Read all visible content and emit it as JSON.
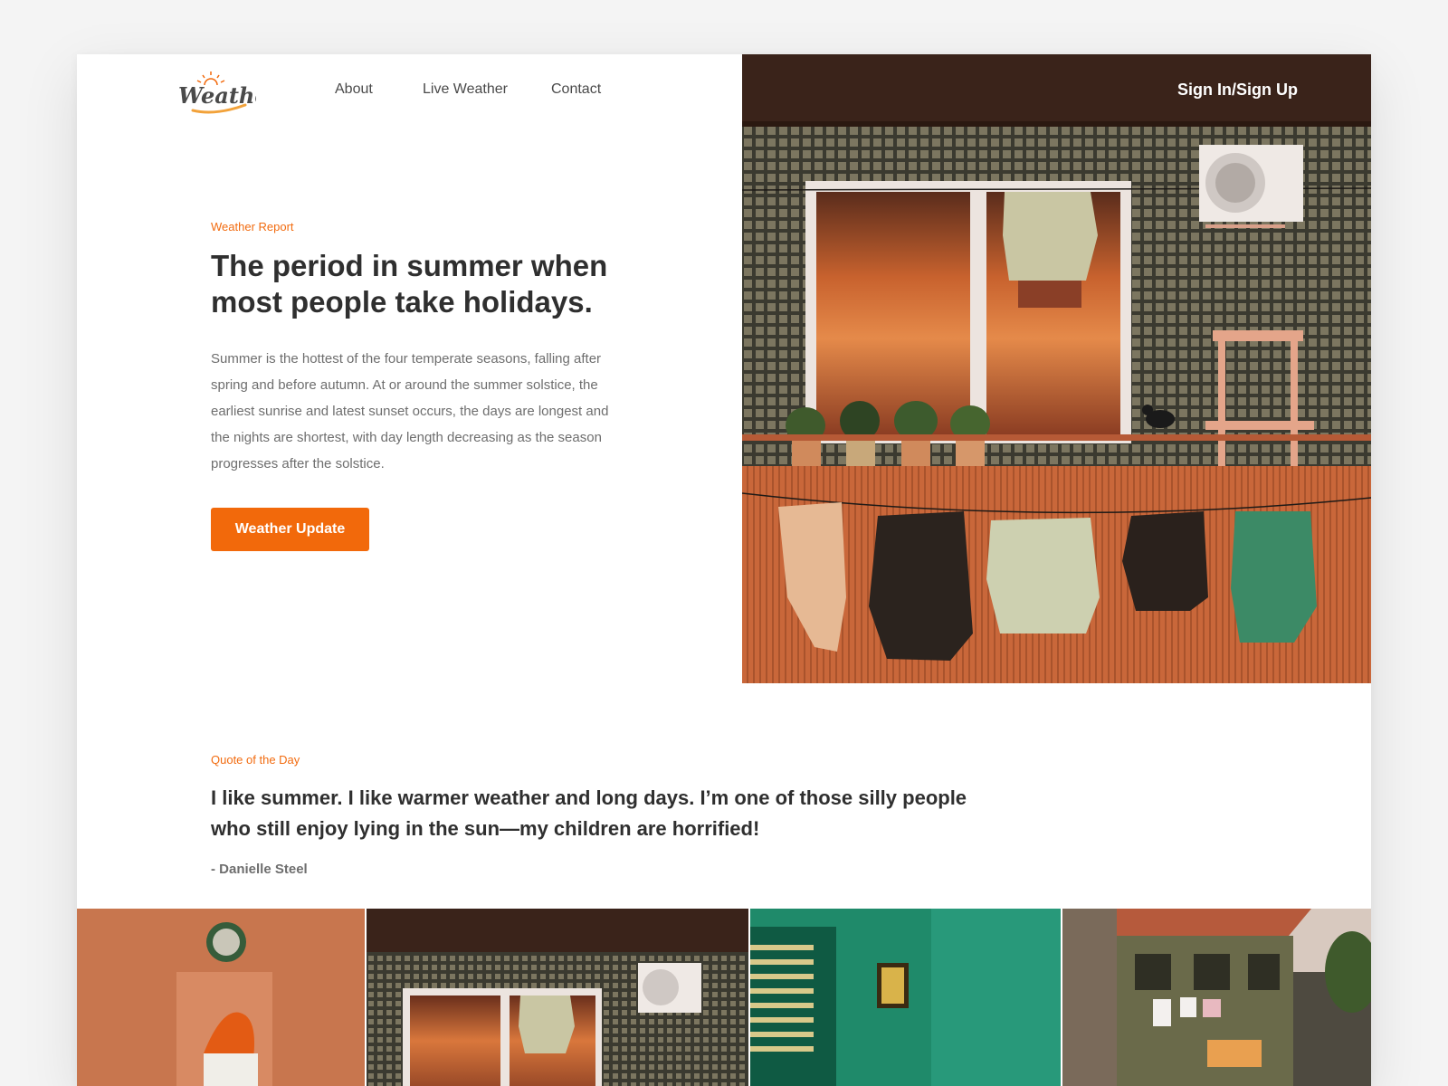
{
  "brand": {
    "logo_text": "Weather"
  },
  "nav": {
    "items": [
      "About",
      "Live Weather",
      "Contact"
    ],
    "signin": "Sign In/Sign Up"
  },
  "hero": {
    "eyebrow": "Weather Report",
    "title": "The period in summer when most people take holidays.",
    "body": "Summer is the hottest of the four temperate seasons, falling after spring and before autumn. At or around the summer solstice, the earliest sunrise and latest sunset occurs, the days are longest and the nights are shortest, with day length decreasing as the season progresses after the solstice.",
    "cta": "Weather Update",
    "image": "balcony-laundry-photo"
  },
  "quote": {
    "eyebrow": "Quote of the Day",
    "text": "I like summer. I like warmer weather and long days. I’m one of those silly people who still enjoy lying in the sun—my children are horrified!",
    "author": "- Danielle Steel"
  },
  "gallery": [
    "orange-wall-figure-photo",
    "balcony-photo",
    "green-room-photo",
    "wooden-house-photo"
  ],
  "colors": {
    "accent": "#f2690b",
    "heading": "#2f2f2f",
    "body": "#6e6e6e",
    "background": "#ffffff"
  }
}
